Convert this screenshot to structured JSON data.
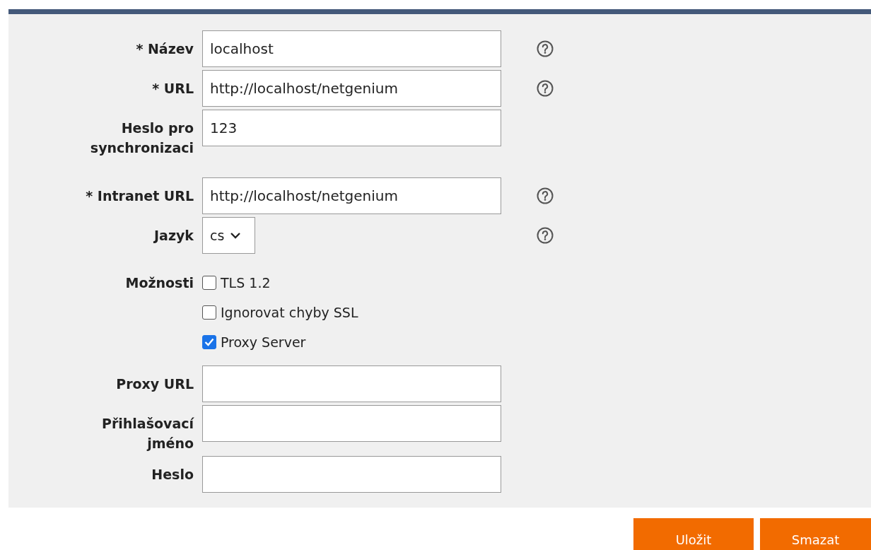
{
  "groups": [
    [
      {
        "kind": "text",
        "label": "* Název",
        "value": "localhost",
        "help": true
      },
      {
        "kind": "text",
        "label": "* URL",
        "value": "http://localhost/netgenium",
        "help": true
      },
      {
        "kind": "text",
        "label": "Heslo pro synchronizaci",
        "value": "123",
        "help": false
      }
    ],
    [
      {
        "kind": "text",
        "label": "* Intranet URL",
        "value": "http://localhost/netgenium",
        "help": true
      },
      {
        "kind": "select",
        "label": "Jazyk",
        "value": "cs",
        "help": true
      }
    ],
    [
      {
        "kind": "checkboxes",
        "label": "Možnosti",
        "options": [
          {
            "label": "TLS 1.2",
            "checked": false
          },
          {
            "label": "Ignorovat chyby SSL",
            "checked": false
          },
          {
            "label": "Proxy Server",
            "checked": true
          }
        ],
        "help": false
      },
      {
        "kind": "text",
        "label": "Proxy URL",
        "help": false
      },
      {
        "kind": "text",
        "label": "Přihlašovací jméno",
        "help": false
      },
      {
        "kind": "text",
        "label": "Heslo",
        "help": false
      }
    ]
  ],
  "buttons": [
    "Uložit",
    "Smazat"
  ]
}
